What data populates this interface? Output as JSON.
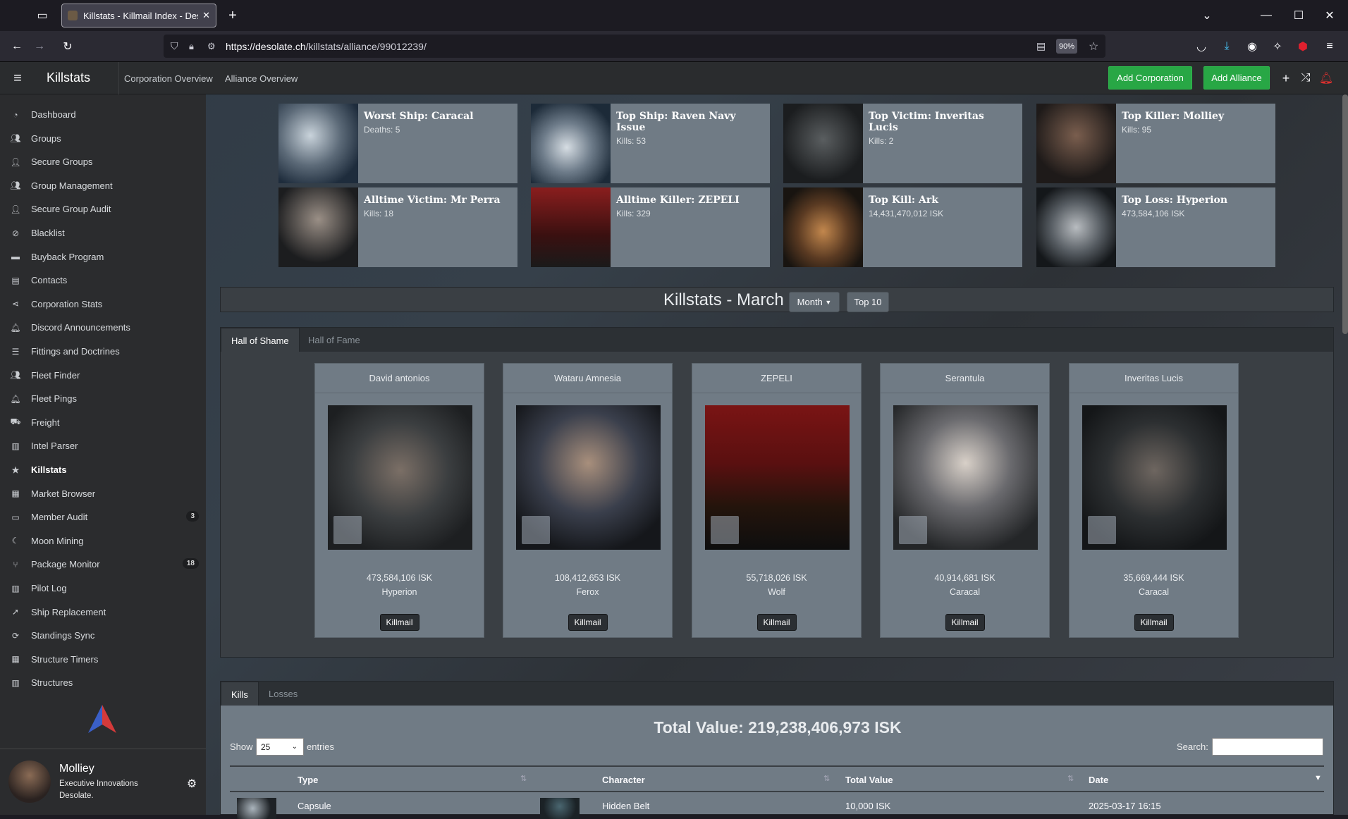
{
  "browser": {
    "tab_title": "Killstats - Killmail Index - Desola",
    "url_host": "https://desolate.ch",
    "url_path": "/killstats/alliance/99012239/",
    "zoom": "90%"
  },
  "topnav": {
    "brand": "Killstats",
    "links": [
      "Corporation Overview",
      "Alliance Overview"
    ],
    "add_corporation": "Add Corporation",
    "add_alliance": "Add Alliance"
  },
  "sidebar": {
    "items": [
      {
        "label": "Dashboard",
        "icon": "dashboard-icon"
      },
      {
        "label": "Groups",
        "icon": "users-icon"
      },
      {
        "label": "Secure Groups",
        "icon": "user-lock-icon"
      },
      {
        "label": "Group Management",
        "icon": "users-cog-icon"
      },
      {
        "label": "Secure Group Audit",
        "icon": "user-check-icon"
      },
      {
        "label": "Blacklist",
        "icon": "ban-icon"
      },
      {
        "label": "Buyback Program",
        "icon": "box-icon"
      },
      {
        "label": "Contacts",
        "icon": "address-book-icon"
      },
      {
        "label": "Corporation Stats",
        "icon": "share-icon"
      },
      {
        "label": "Discord Announcements",
        "icon": "bell-icon"
      },
      {
        "label": "Fittings and Doctrines",
        "icon": "list-icon"
      },
      {
        "label": "Fleet Finder",
        "icon": "users-icon"
      },
      {
        "label": "Fleet Pings",
        "icon": "bell-icon"
      },
      {
        "label": "Freight",
        "icon": "truck-icon"
      },
      {
        "label": "Intel Parser",
        "icon": "clipboard-icon"
      },
      {
        "label": "Killstats",
        "icon": "star-icon",
        "badge": ""
      },
      {
        "label": "Market Browser",
        "icon": "store-icon"
      },
      {
        "label": "Member Audit",
        "icon": "id-card-icon",
        "badge": "3"
      },
      {
        "label": "Moon Mining",
        "icon": "moon-icon"
      },
      {
        "label": "Package Monitor",
        "icon": "code-branch-icon",
        "badge": "18"
      },
      {
        "label": "Pilot Log",
        "icon": "clipboard-icon"
      },
      {
        "label": "Ship Replacement",
        "icon": "rocket-icon"
      },
      {
        "label": "Standings Sync",
        "icon": "sync-icon"
      },
      {
        "label": "Structure Timers",
        "icon": "calendar-icon"
      },
      {
        "label": "Structures",
        "icon": "building-icon"
      }
    ],
    "user": {
      "name": "Molliey",
      "corp": "Executive Innovations",
      "alliance": "Desolate."
    }
  },
  "cards": [
    {
      "title": "Worst Ship: Caracal",
      "sub": "Deaths: 5"
    },
    {
      "title": "Top Ship: Raven Navy Issue",
      "sub": "Kills: 53"
    },
    {
      "title": "Top Victim: Inveritas Lucis",
      "sub": "Kills: 2"
    },
    {
      "title": "Top Killer: Molliey",
      "sub": "Kills: 95"
    },
    {
      "title": "Alltime Victim: Mr Perra",
      "sub": "Kills: 18"
    },
    {
      "title": "Alltime Killer: ZEPELI",
      "sub": "Kills: 329"
    },
    {
      "title": "Top Kill: Ark",
      "sub": "14,431,470,012 ISK"
    },
    {
      "title": "Top Loss: Hyperion",
      "sub": "473,584,106 ISK"
    }
  ],
  "header": {
    "title": "Killstats - March",
    "period": "Month",
    "top": "Top 10"
  },
  "hall_tabs": [
    "Hall of Shame",
    "Hall of Fame"
  ],
  "shame": [
    {
      "name": "David antonios",
      "value": "473,584,106 ISK",
      "ship": "Hyperion",
      "button": "Killmail"
    },
    {
      "name": "Wataru Amnesia",
      "value": "108,412,653 ISK",
      "ship": "Ferox",
      "button": "Killmail"
    },
    {
      "name": "ZEPELI",
      "value": "55,718,026 ISK",
      "ship": "Wolf",
      "button": "Killmail"
    },
    {
      "name": "Serantula",
      "value": "40,914,681 ISK",
      "ship": "Caracal",
      "button": "Killmail"
    },
    {
      "name": "Inveritas Lucis",
      "value": "35,669,444 ISK",
      "ship": "Caracal",
      "button": "Killmail"
    }
  ],
  "kl_tabs": [
    "Kills",
    "Losses"
  ],
  "table": {
    "total": "Total Value: 219,238,406,973 ISK",
    "show_label": "Show",
    "show_value": "25",
    "entries_label": "entries",
    "search_label": "Search:",
    "columns": [
      "Type",
      "Character",
      "Total Value",
      "Date"
    ],
    "rows": [
      {
        "type": "Capsule",
        "character": "Hidden Belt",
        "value": "10,000 ISK",
        "date": "2025-03-17 16:15"
      }
    ]
  },
  "colors": {
    "green": "#28a745",
    "sidebar": "#2b2c2e",
    "card": "#707b85"
  }
}
